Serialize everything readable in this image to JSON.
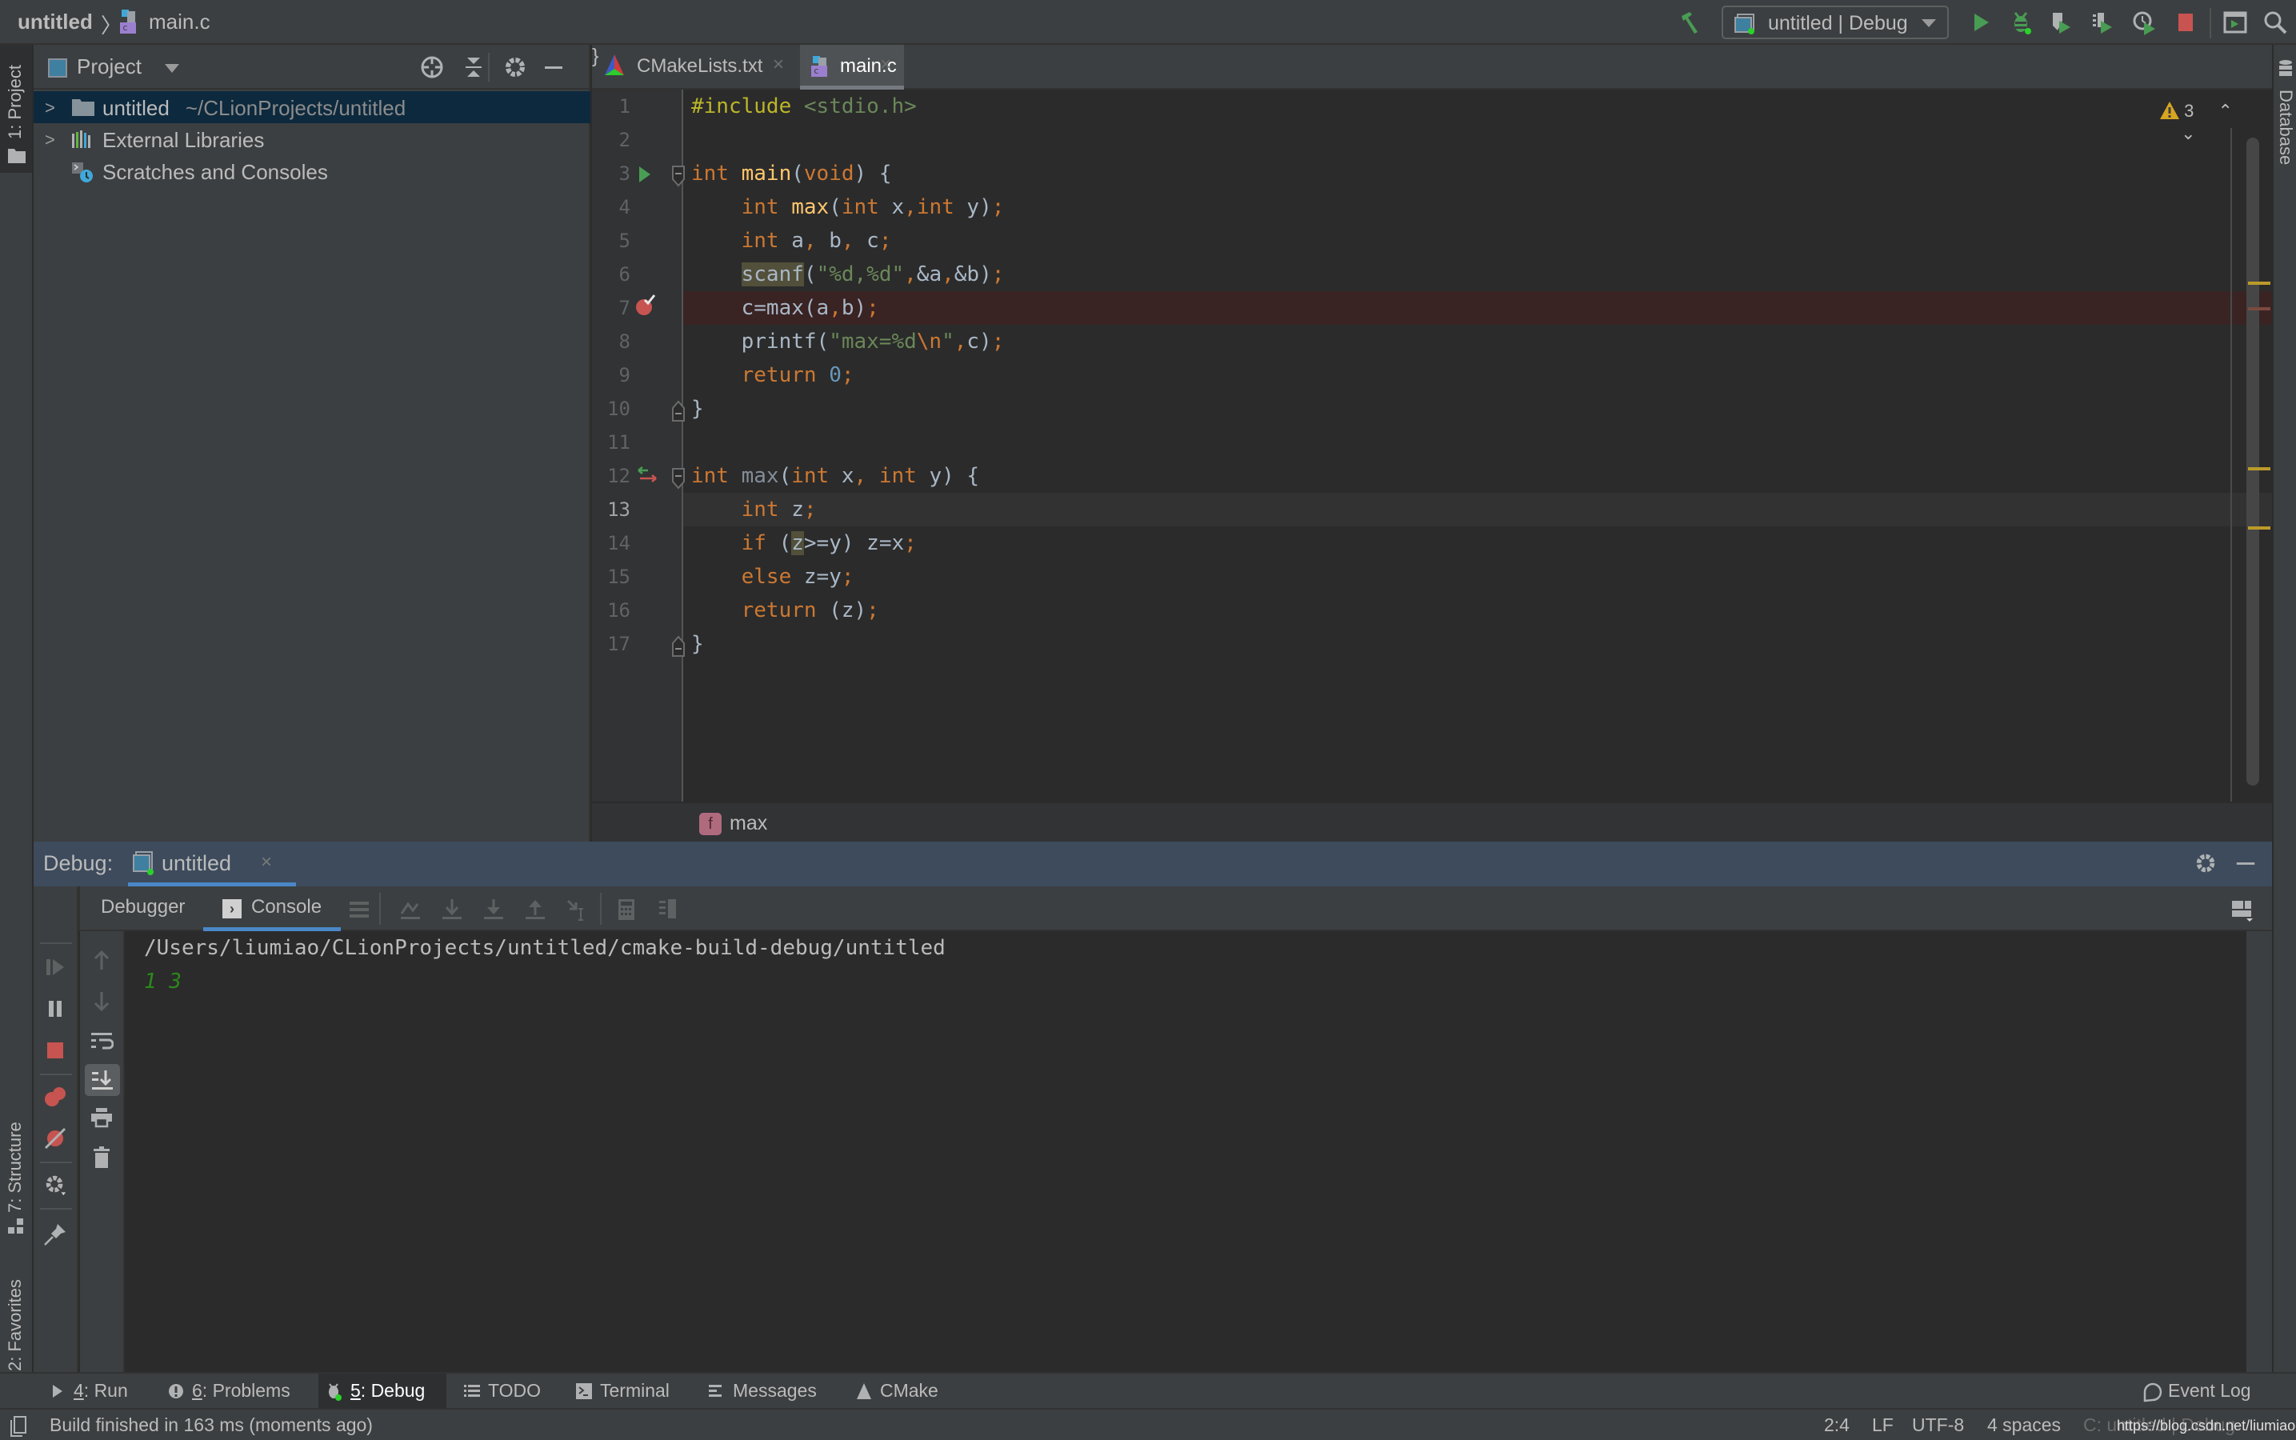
{
  "navbar": {
    "project": "untitled",
    "separator": "〉",
    "file": "main.c",
    "run_config": "untitled | Debug",
    "icons": [
      "build-hammer-icon",
      "run-icon",
      "debug-icon",
      "run-with-coverage-icon",
      "run-with-profiler-icon",
      "profile-icon",
      "stop-icon",
      "run-anything-icon",
      "search-everywhere-icon"
    ]
  },
  "left_stripe": {
    "tabs": [
      {
        "label": "1: Project",
        "active": true
      },
      {
        "label": "7: Structure",
        "active": false
      },
      {
        "label": "2: Favorites",
        "active": false
      }
    ]
  },
  "right_stripe": {
    "tabs": [
      {
        "label": "Database"
      }
    ]
  },
  "project_panel": {
    "title": "Project",
    "tree": [
      {
        "label": "untitled",
        "path": "~/CLionProjects/untitled",
        "expandable": true,
        "selected": true,
        "icon": "folder-icon"
      },
      {
        "label": "External Libraries",
        "path": "",
        "expandable": true,
        "selected": false,
        "icon": "libraries-icon"
      },
      {
        "label": "Scratches and Consoles",
        "path": "",
        "expandable": false,
        "selected": false,
        "icon": "scratches-icon"
      }
    ]
  },
  "editor": {
    "tabs": [
      {
        "label": "CMakeLists.txt",
        "active": false,
        "close": "×"
      },
      {
        "label": "main.c",
        "active": true,
        "close": "×"
      }
    ],
    "warnings_count": "3",
    "breakpoint_line": 7,
    "caret_line": 13,
    "lines": [
      "#include <stdio.h>",
      "",
      "int main(void) {",
      "    int max(int x,int y);",
      "    int a, b, c;",
      "    scanf(\"%d,%d\",&a,&b);",
      "    c=max(a,b);",
      "    printf(\"max=%d\\n\",c);",
      "    return 0;",
      "}",
      "",
      "int max(int x, int y) {",
      "    int z;",
      "    if (z>=y) z=x;",
      "    else z=y;",
      "    return (z);",
      "}"
    ],
    "breadcrumb": {
      "badge": "f",
      "label": "max"
    }
  },
  "debug": {
    "title": "Debug:",
    "session_tab": "untitled",
    "session_close": "×",
    "sub_tabs": [
      {
        "label": "Debugger",
        "active": false
      },
      {
        "label": "Console",
        "active": true
      }
    ],
    "console": {
      "command": "/Users/liumiao/CLionProjects/untitled/cmake-build-debug/untitled",
      "input": "1 3"
    }
  },
  "tool_windows": [
    {
      "num": "4",
      "label": ": Run",
      "active": false,
      "icon": "run-icon"
    },
    {
      "num": "6",
      "label": ": Problems",
      "active": false,
      "icon": "problems-icon"
    },
    {
      "num": "5",
      "label": ": Debug",
      "active": true,
      "icon": "debug-icon"
    },
    {
      "num": "",
      "label": "TODO",
      "active": false,
      "icon": "todo-icon"
    },
    {
      "num": "",
      "label": "Terminal",
      "active": false,
      "icon": "terminal-icon"
    },
    {
      "num": "",
      "label": "Messages",
      "active": false,
      "icon": "messages-icon"
    },
    {
      "num": "",
      "label": "CMake",
      "active": false,
      "icon": "cmake-icon"
    }
  ],
  "event_log": "Event Log",
  "status_bar": {
    "message": "Build finished in 163 ms (moments ago)",
    "position": "2:4",
    "line_sep": "LF",
    "encoding": "UTF-8",
    "indent": "4 spaces",
    "context": "C: untitled | Debug",
    "watermark": "https://blog.csdn.net/liumiaocn"
  },
  "colors": {
    "accent_blue": "#4a88c7",
    "run_green": "#499c54",
    "stop_red": "#c75450",
    "warning_yellow": "#d7a520",
    "keyword": "#cc7832",
    "string": "#6a8759",
    "function": "#ffc66d"
  }
}
